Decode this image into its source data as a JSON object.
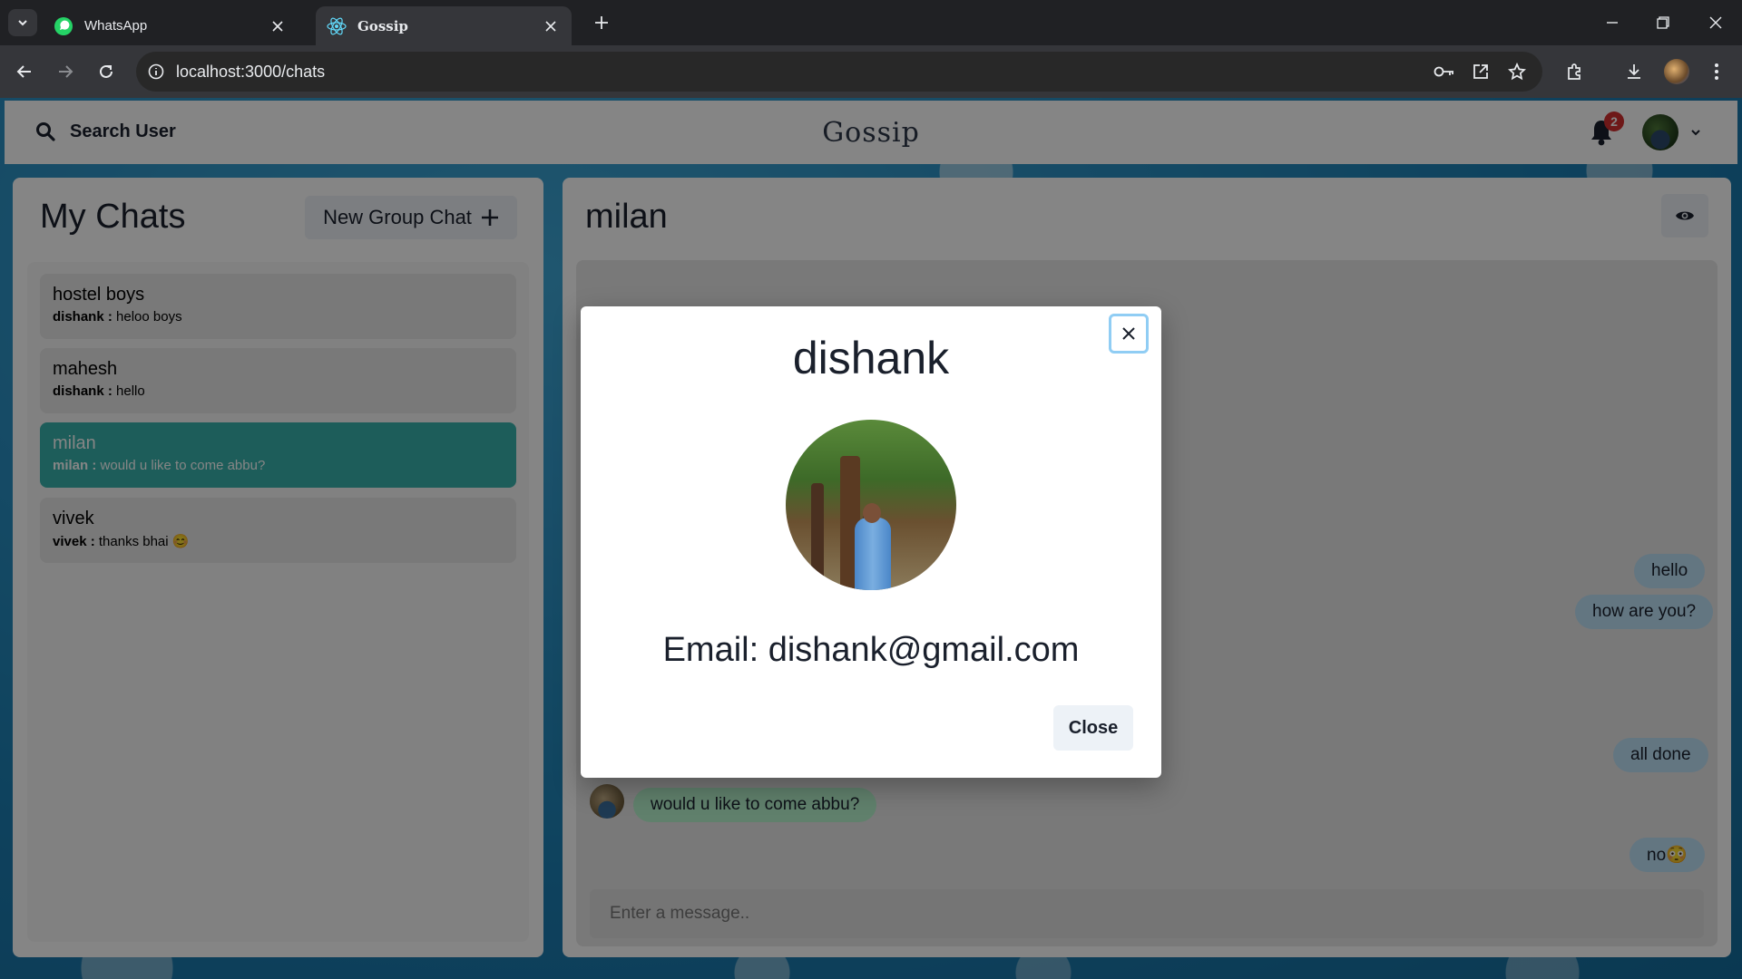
{
  "browser": {
    "tabs": [
      {
        "title": "WhatsApp",
        "icon": "whatsapp-icon"
      },
      {
        "title": "Gossip",
        "icon": "react-icon"
      }
    ],
    "url": "localhost:3000/chats",
    "colors": {
      "frame": "#202124",
      "toolbar": "#35363a"
    }
  },
  "header": {
    "search_label": "Search User",
    "brand": "Gossip",
    "notification_count": "2"
  },
  "my_chats": {
    "title": "My Chats",
    "new_group_label": "New Group Chat",
    "chats": [
      {
        "name": "hostel boys",
        "sender": "dishank :",
        "message": "heloo boys",
        "active": false
      },
      {
        "name": "mahesh",
        "sender": "dishank :",
        "message": "hello",
        "active": false
      },
      {
        "name": "milan",
        "sender": "milan :",
        "message": "would u like to come abbu?",
        "active": true
      },
      {
        "name": "vivek",
        "sender": "vivek :",
        "message": "thanks bhai 😊",
        "active": false
      }
    ]
  },
  "chat": {
    "title": "milan",
    "messages": [
      {
        "text": "hello",
        "direction": "out"
      },
      {
        "text": "how are you?",
        "direction": "out"
      },
      {
        "text": "all done",
        "direction": "out"
      },
      {
        "text": "would u like to come abbu?",
        "direction": "in"
      },
      {
        "text": "no😳",
        "direction": "out"
      }
    ],
    "input_placeholder": "Enter a message.."
  },
  "modal": {
    "title": "dishank",
    "email": "Email: dishank@gmail.com",
    "close_label": "Close"
  },
  "colors": {
    "active_chat": "#38b2ac",
    "outgoing_bubble": "#bee3f8",
    "incoming_bubble": "#b9f5d0",
    "badge": "#d32f2f"
  }
}
